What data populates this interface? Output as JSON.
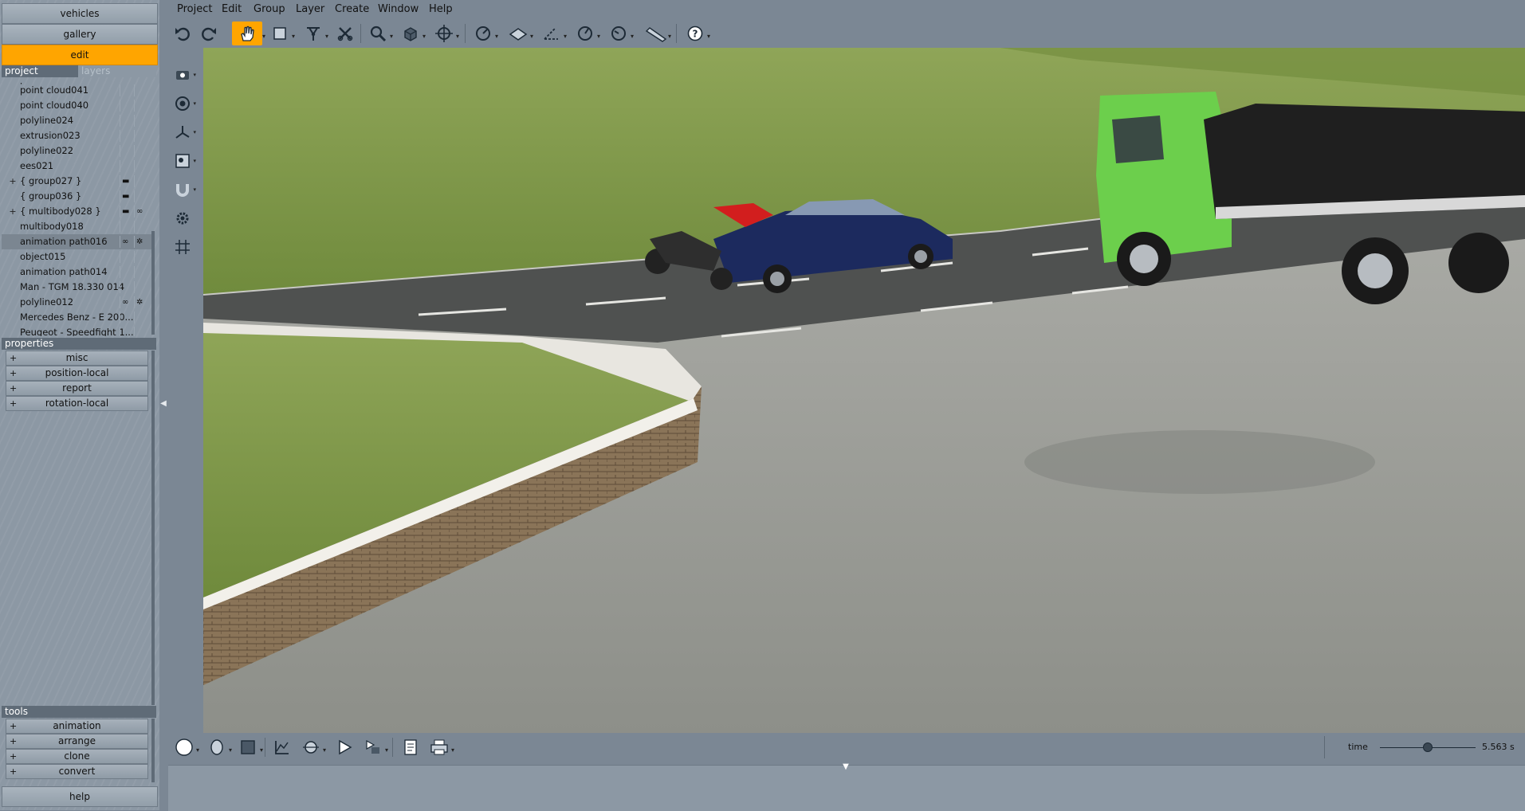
{
  "modes": {
    "vehicles": "vehicles",
    "gallery": "gallery",
    "edit": "edit",
    "help": "help"
  },
  "project_panel": {
    "tab_project": "project",
    "tab_layers": "layers",
    "items": [
      {
        "label": "point cloud041",
        "expander": "",
        "icons": []
      },
      {
        "label": "point cloud040",
        "expander": "",
        "icons": []
      },
      {
        "label": "polyline024",
        "expander": "",
        "icons": []
      },
      {
        "label": "extrusion023",
        "expander": "",
        "icons": []
      },
      {
        "label": "polyline022",
        "expander": "",
        "icons": []
      },
      {
        "label": "ees021",
        "expander": "",
        "icons": []
      },
      {
        "label": "{ group027 }",
        "expander": "+",
        "icons": [
          "folder-icon"
        ]
      },
      {
        "label": "{ group036 }",
        "expander": "",
        "icons": [
          "folder-icon"
        ]
      },
      {
        "label": "{ multibody028 }",
        "expander": "+",
        "icons": [
          "folder-icon",
          "link-icon"
        ]
      },
      {
        "label": "multibody018",
        "expander": "",
        "icons": []
      },
      {
        "label": "animation path016",
        "expander": "",
        "icons": [
          "link-icon",
          "gear-icon"
        ],
        "selected": true
      },
      {
        "label": "object015",
        "expander": "",
        "icons": []
      },
      {
        "label": "animation path014",
        "expander": "",
        "icons": []
      },
      {
        "label": "Man - TGM 18.330 014",
        "expander": "",
        "icons": []
      },
      {
        "label": "polyline012",
        "expander": "",
        "icons": [
          "link-icon",
          "gear-icon"
        ]
      },
      {
        "label": "Mercedes Benz - E 200...",
        "expander": "",
        "icons": []
      },
      {
        "label": "Peugeot - Speedfight 1...",
        "expander": "",
        "icons": []
      }
    ]
  },
  "properties_panel": {
    "title": "properties",
    "items": [
      {
        "label": "misc"
      },
      {
        "label": "position-local"
      },
      {
        "label": "report"
      },
      {
        "label": "rotation-local"
      }
    ]
  },
  "tools_panel": {
    "title": "tools",
    "items": [
      {
        "label": "animation"
      },
      {
        "label": "arrange"
      },
      {
        "label": "clone"
      },
      {
        "label": "convert"
      }
    ]
  },
  "menu": {
    "items": [
      "Project",
      "Edit",
      "Group",
      "Layer",
      "Create",
      "Window",
      "Help"
    ]
  },
  "toolbar_icons": [
    "undo-icon",
    "redo-icon",
    "hand-pan-icon",
    "selection-rect-icon",
    "node-select-icon",
    "cut-tool-icon",
    "zoom-icon",
    "box-view-icon",
    "move-center-icon",
    "measure-gauge-icon",
    "plane-tool-icon",
    "angle-measure-icon",
    "dial-gauge-icon",
    "speed-gauge-icon",
    "ruler-icon",
    "help-icon"
  ],
  "time": {
    "label": "time",
    "value": "5.563 s",
    "position": 0.5
  },
  "colors": {
    "accent": "#ffa500",
    "panel": "#8c98a4",
    "header": "#5f6b77"
  }
}
